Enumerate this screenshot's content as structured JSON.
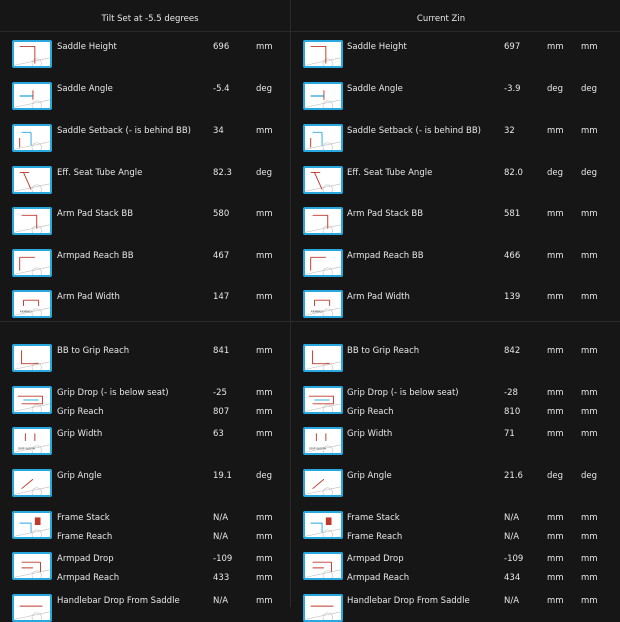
{
  "columns": [
    {
      "title": "Tilt Set at -5.5 degrees",
      "rows": [
        {
          "label": "Saddle Height",
          "value": "696",
          "unit": "mm",
          "icon": "saddle-height-icon"
        },
        {
          "label": "Saddle Angle",
          "value": "-5.4",
          "unit": "deg",
          "icon": "saddle-angle-icon"
        },
        {
          "label": "Saddle Setback (- is behind BB)",
          "value": "34",
          "unit": "mm",
          "icon": "saddle-setback-icon"
        },
        {
          "label": "Eff. Seat Tube Angle",
          "value": "82.3",
          "unit": "deg",
          "icon": "seat-tube-angle-icon"
        },
        {
          "label": "Arm Pad Stack BB",
          "value": "580",
          "unit": "mm",
          "icon": "arm-pad-stack-icon"
        },
        {
          "label": "Armpad Reach BB",
          "value": "467",
          "unit": "mm",
          "icon": "armpad-reach-icon"
        },
        {
          "label": "Arm Pad Width",
          "value": "147",
          "unit": "mm",
          "icon": "arm-pad-width-icon"
        },
        {
          "label": "BB to Grip Reach",
          "value": "841",
          "unit": "mm",
          "icon": "grip-reach-icon"
        },
        {
          "label": "Grip Drop (- is below seat)",
          "value": "-25",
          "unit": "mm",
          "icon": "grip-drop-icon"
        },
        {
          "label": "Grip Reach",
          "value": "807",
          "unit": "mm"
        },
        {
          "label": "Grip Width",
          "value": "63",
          "unit": "mm",
          "icon": "grip-width-icon"
        },
        {
          "label": "Grip Angle",
          "value": "19.1",
          "unit": "deg",
          "icon": "grip-angle-icon"
        },
        {
          "label": "Frame Stack",
          "value": "N/A",
          "unit": "mm",
          "icon": "frame-stack-icon"
        },
        {
          "label": "Frame Reach",
          "value": "N/A",
          "unit": "mm"
        },
        {
          "label": "Armpad Drop",
          "value": "-109",
          "unit": "mm",
          "icon": "armpad-drop-icon"
        },
        {
          "label": "Armpad Reach",
          "value": "433",
          "unit": "mm"
        },
        {
          "label": "Handlebar Drop From Saddle",
          "value": "N/A",
          "unit": "mm",
          "icon": "handlebar-drop-icon"
        }
      ]
    },
    {
      "title": "Current Zin",
      "rows": [
        {
          "label": "Saddle Height",
          "value": "697",
          "unit": "mm",
          "unit2": "mm",
          "icon": "saddle-height-icon"
        },
        {
          "label": "Saddle Angle",
          "value": "-3.9",
          "unit": "deg",
          "unit2": "deg",
          "icon": "saddle-angle-icon"
        },
        {
          "label": "Saddle Setback (- is behind BB)",
          "value": "32",
          "unit": "mm",
          "unit2": "mm",
          "icon": "saddle-setback-icon"
        },
        {
          "label": "Eff. Seat Tube Angle",
          "value": "82.0",
          "unit": "deg",
          "unit2": "deg",
          "icon": "seat-tube-angle-icon"
        },
        {
          "label": "Arm Pad Stack BB",
          "value": "581",
          "unit": "mm",
          "unit2": "mm",
          "icon": "arm-pad-stack-icon"
        },
        {
          "label": "Armpad Reach BB",
          "value": "466",
          "unit": "mm",
          "unit2": "mm",
          "icon": "armpad-reach-icon"
        },
        {
          "label": "Arm Pad Width",
          "value": "139",
          "unit": "mm",
          "unit2": "mm",
          "icon": "arm-pad-width-icon"
        },
        {
          "label": "BB to Grip Reach",
          "value": "842",
          "unit": "mm",
          "unit2": "mm",
          "icon": "grip-reach-icon"
        },
        {
          "label": "Grip Drop (- is below seat)",
          "value": "-28",
          "unit": "mm",
          "unit2": "mm",
          "icon": "grip-drop-icon"
        },
        {
          "label": "Grip Reach",
          "value": "810",
          "unit": "mm",
          "unit2": "mm"
        },
        {
          "label": "Grip Width",
          "value": "71",
          "unit": "mm",
          "unit2": "mm",
          "icon": "grip-width-icon"
        },
        {
          "label": "Grip Angle",
          "value": "21.6",
          "unit": "deg",
          "unit2": "deg",
          "icon": "grip-angle-icon"
        },
        {
          "label": "Frame Stack",
          "value": "N/A",
          "unit": "mm",
          "unit2": "mm",
          "icon": "frame-stack-icon"
        },
        {
          "label": "Frame Reach",
          "value": "N/A",
          "unit": "mm",
          "unit2": "mm"
        },
        {
          "label": "Armpad Drop",
          "value": "-109",
          "unit": "mm",
          "unit2": "mm",
          "icon": "armpad-drop-icon"
        },
        {
          "label": "Armpad Reach",
          "value": "434",
          "unit": "mm",
          "unit2": "mm"
        },
        {
          "label": "Handlebar Drop From Saddle",
          "value": "N/A",
          "unit": "mm",
          "unit2": "mm",
          "icon": "handlebar-drop-icon"
        }
      ]
    }
  ],
  "colors": {
    "thumb_border": "#29a8e0",
    "measure_red": "#c0392b",
    "measure_blue": "#29a8e0",
    "bg": "#161616"
  }
}
